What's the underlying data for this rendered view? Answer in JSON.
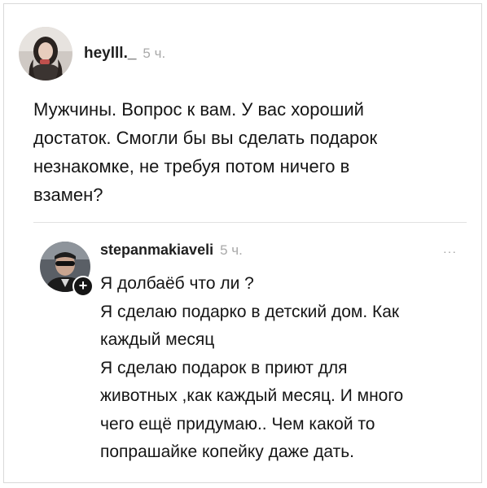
{
  "post": {
    "username": "heylll._",
    "time": "5 ч.",
    "avatar_icon": "user-photo-avatar",
    "lines": [
      "Мужчины. Вопрос к вам. У вас хороший",
      "достаток. Смогли бы вы сделать подарок",
      "незнакомке, не требуя потом ничего в",
      "взамен?"
    ]
  },
  "reply": {
    "username": "stepanmakiaveli",
    "time": "5 ч.",
    "avatar_icon": "user-photo-avatar",
    "follow_badge": "+",
    "more_icon": "···",
    "lines": [
      "Я долбаёб что ли ?",
      "Я сделаю подарко в детский дом. Как",
      "каждый месяц",
      "Я сделаю подарок в приют для",
      "животных ,как каждый месяц. И много",
      "чего ещё придумаю.. Чем какой то",
      "попрашайке копейку даже дать."
    ]
  }
}
